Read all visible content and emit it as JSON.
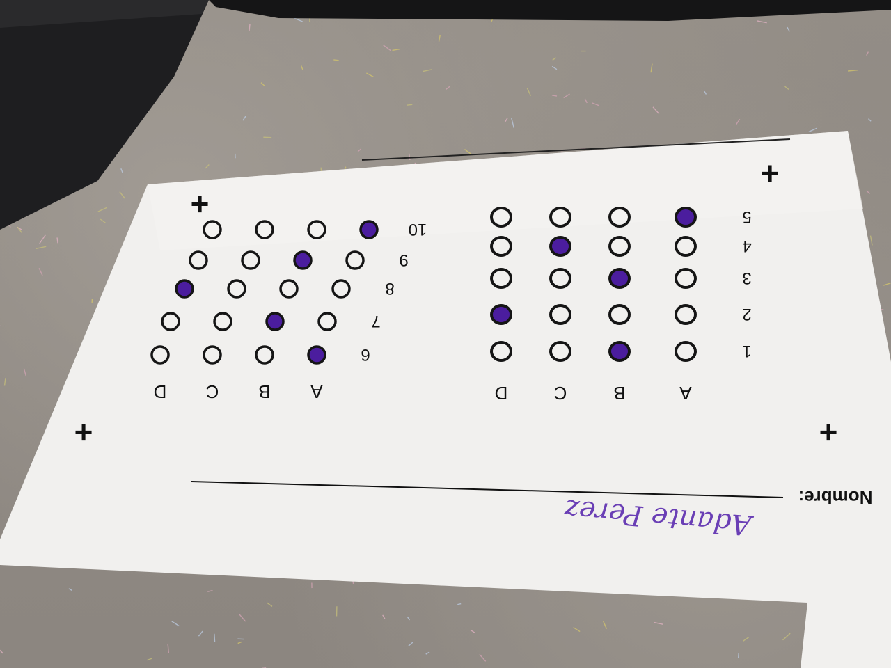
{
  "sheet": {
    "name_label": "Nombre:",
    "student_name": "Adante Perez",
    "registration_mark": "+",
    "ink_color": "#4b1d9e",
    "columns": [
      "A",
      "B",
      "C",
      "D"
    ],
    "right_block": {
      "rows": [
        {
          "number": "1",
          "marked": "B"
        },
        {
          "number": "2",
          "marked": "D"
        },
        {
          "number": "3",
          "marked": "B"
        },
        {
          "number": "4",
          "marked": "C"
        },
        {
          "number": "5",
          "marked": "A"
        }
      ]
    },
    "left_block": {
      "rows": [
        {
          "number": "6",
          "marked": "A"
        },
        {
          "number": "7",
          "marked": "B"
        },
        {
          "number": "8",
          "marked": "D"
        },
        {
          "number": "9",
          "marked": "B"
        },
        {
          "number": "10",
          "marked": "A"
        }
      ]
    },
    "bubble_glyph": "O"
  }
}
